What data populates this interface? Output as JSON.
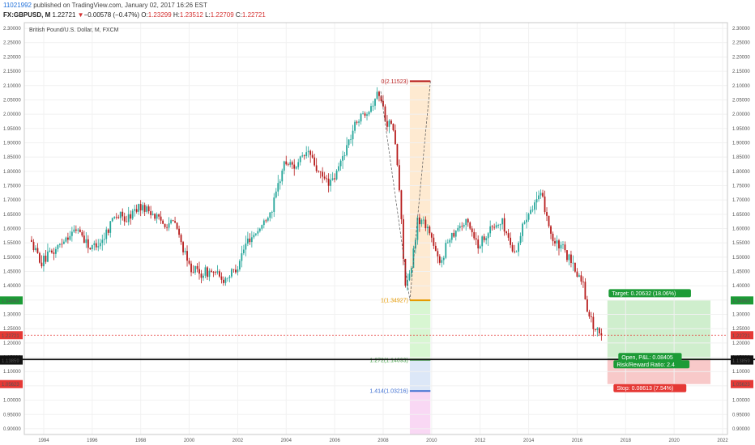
{
  "header": {
    "publish_id": "11021992",
    "publish_text": " published on TradingView.com, January 02, 2017 16:26 EST",
    "symbol": "FX:GBPUSD,",
    "interval": "M",
    "last": "1.22721",
    "down_arrow": "▼",
    "change": "−0.00578 (−0.47%)",
    "o_label": "O:",
    "o_val": "1.23299",
    "h_label": "H:",
    "h_val": "1.23512",
    "l_label": "L:",
    "l_val": "1.22709",
    "c_label": "C:",
    "c_val": "1.22721"
  },
  "chart_data": {
    "type": "candlestick",
    "title": "British Pound/U.S. Dollar, M, FXCM",
    "ylim": [
      0.88,
      2.32
    ],
    "xlim": [
      1993.2,
      2022.2
    ],
    "y_ticks": [
      "2.30000",
      "2.25000",
      "2.20000",
      "2.15000",
      "2.10000",
      "2.05000",
      "2.00000",
      "1.95000",
      "1.90000",
      "1.85000",
      "1.80000",
      "1.75000",
      "1.70000",
      "1.65000",
      "1.60000",
      "1.55000",
      "1.50000",
      "1.45000",
      "1.40000",
      "1.35000",
      "1.30000",
      "1.25000",
      "1.20000",
      "1.15000",
      "1.10000",
      "1.05000",
      "1.00000",
      "0.95000",
      "0.90000"
    ],
    "x_ticks": [
      "1994",
      "1996",
      "1998",
      "2000",
      "2002",
      "2004",
      "2006",
      "2008",
      "2010",
      "2012",
      "2014",
      "2016",
      "2018",
      "2020",
      "2022"
    ],
    "trend": {
      "t": [
        1993.5,
        1994.0,
        1994.5,
        1995.0,
        1995.5,
        1996.0,
        1996.5,
        1997.0,
        1997.5,
        1998.0,
        1998.5,
        1999.0,
        1999.5,
        2000.0,
        2000.5,
        2001.0,
        2001.5,
        2002.0,
        2002.5,
        2003.0,
        2003.5,
        2004.0,
        2004.5,
        2005.0,
        2005.5,
        2006.0,
        2006.5,
        2007.0,
        2007.5,
        2007.9,
        2008.2,
        2008.5,
        2008.7,
        2009.0,
        2009.2,
        2009.5,
        2009.8,
        2010.0,
        2010.4,
        2010.8,
        2011.2,
        2011.6,
        2012.0,
        2012.5,
        2013.0,
        2013.5,
        2014.0,
        2014.4,
        2014.6,
        2014.8,
        2015.1,
        2015.5,
        2016.0,
        2016.3,
        2016.5,
        2016.8,
        2017.0
      ],
      "price": [
        1.56,
        1.48,
        1.52,
        1.57,
        1.6,
        1.53,
        1.56,
        1.65,
        1.63,
        1.68,
        1.66,
        1.62,
        1.62,
        1.48,
        1.44,
        1.45,
        1.42,
        1.46,
        1.56,
        1.6,
        1.67,
        1.83,
        1.82,
        1.87,
        1.78,
        1.76,
        1.87,
        1.98,
        2.02,
        2.08,
        1.98,
        1.95,
        1.8,
        1.4,
        1.43,
        1.63,
        1.62,
        1.59,
        1.47,
        1.57,
        1.61,
        1.62,
        1.54,
        1.6,
        1.62,
        1.51,
        1.65,
        1.7,
        1.71,
        1.66,
        1.55,
        1.53,
        1.45,
        1.42,
        1.32,
        1.25,
        1.227
      ]
    },
    "fib_levels": [
      {
        "ratio": "0",
        "value": "2.11523",
        "price": 2.11523,
        "color": "#b71c1c"
      },
      {
        "ratio": "1",
        "value": "1.34927",
        "price": 1.34927,
        "color": "#e69a00"
      },
      {
        "ratio": "1.272",
        "value": "1.14093",
        "price": 1.14093,
        "color": "#43a047"
      },
      {
        "ratio": "1.414",
        "value": "1.03216",
        "price": 1.03216,
        "color": "#3f6fd1"
      }
    ],
    "position": {
      "target_label": "Target: 0.20632 (18.06%)",
      "open_label": "Open, P&L: 0.08405",
      "rr_label": "Risk/Reward Ratio: 2.4",
      "stop_label": "Stop: 0.08613 (7.54%)",
      "target_price": 1.34868,
      "entry_price": 1.14236,
      "stop_price": 1.05623
    },
    "price_tags": [
      {
        "value": "1.34868",
        "price": 1.34868,
        "bg": "#1c9b36",
        "fg": "#ffffff"
      },
      {
        "value": "1.22721",
        "price": 1.22721,
        "bg": "#e53935",
        "fg": "#ffffff"
      },
      {
        "value": "1.14236",
        "price": 1.14236,
        "bg": "#111111",
        "fg": "#ffffff"
      },
      {
        "value": "1.13859",
        "price": 1.13859,
        "bg": "#111111",
        "fg": "#ffffff"
      },
      {
        "value": "1.05623",
        "price": 1.05623,
        "bg": "#e53935",
        "fg": "#ffffff"
      }
    ],
    "colors": {
      "up": "#26a69a",
      "down": "#b71c1c",
      "current": "#e53935",
      "target_zone": "#cfeecd",
      "stop_zone": "#f8c9c9"
    }
  }
}
